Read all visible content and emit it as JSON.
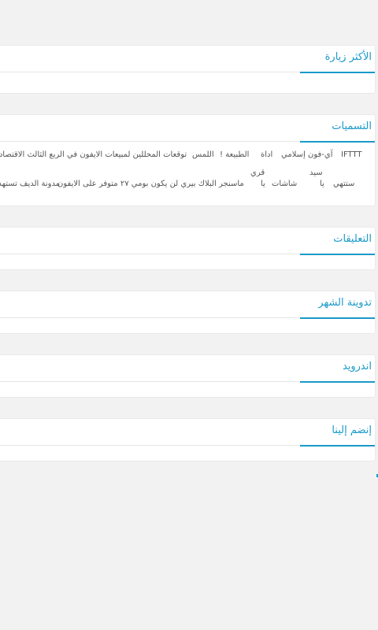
{
  "widgets": {
    "most_visited": {
      "title": "الأكثر زيارة"
    },
    "labels": {
      "title": "التسميات",
      "tags": [
        "IFTTT",
        "آي-فون إسلامي",
        "اداة",
        "الطبيعة !",
        "اللمس",
        "توقعات المحللين لمبيعات الايفون في الربع الثالث الاقتصادي",
        "سيد",
        "قري",
        "ستتهي",
        "يا",
        "شاشات",
        "يا",
        "ماسنجر البلاك بيري لن يكون بومي ٢٧ متوفر على الايفون",
        "مدونة الديف تستهدف"
      ]
    },
    "comments": {
      "title": "التعليقات"
    },
    "post_of_month": {
      "title": "تدوينة الشهر"
    },
    "android": {
      "title": "اندرويد"
    },
    "join_us": {
      "title": "إنضم إلينا"
    }
  },
  "colors": {
    "accent": "#1a99c9",
    "background": "#f2f2f2",
    "card": "#ffffff",
    "text": "#555555"
  }
}
